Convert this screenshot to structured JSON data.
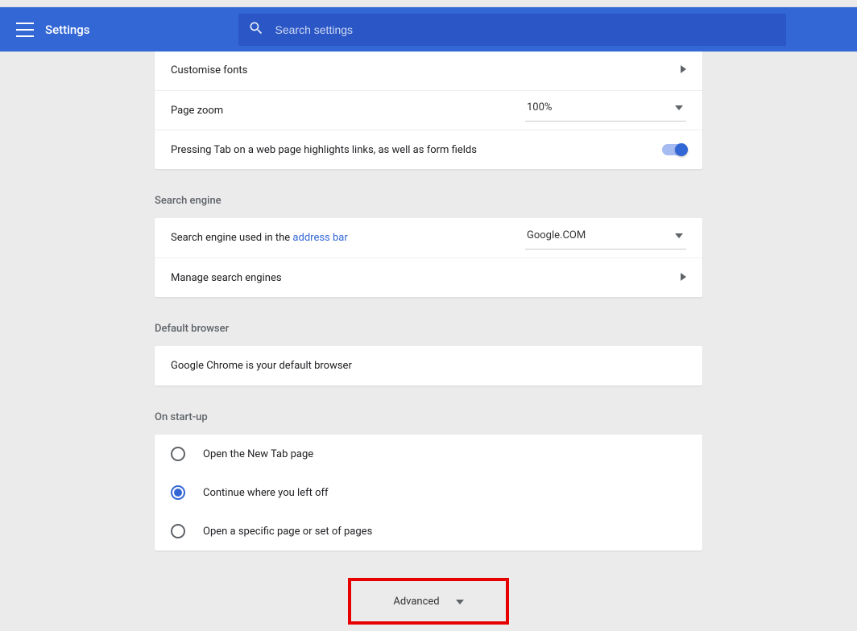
{
  "header": {
    "title": "Settings",
    "search_placeholder": "Search settings"
  },
  "appearance": {
    "customise_fonts": "Customise fonts",
    "page_zoom_label": "Page zoom",
    "page_zoom_value": "100%",
    "tab_highlight": "Pressing Tab on a web page highlights links, as well as form fields"
  },
  "search_engine": {
    "section": "Search engine",
    "used_in_prefix": "Search engine used in the ",
    "address_bar_link": "address bar",
    "value": "Google.COM",
    "manage": "Manage search engines"
  },
  "default_browser": {
    "section": "Default browser",
    "status": "Google Chrome is your default browser"
  },
  "on_startup": {
    "section": "On start-up",
    "opt1": "Open the New Tab page",
    "opt2": "Continue where you left off",
    "opt3": "Open a specific page or set of pages",
    "selected_index": 1
  },
  "advanced_label": "Advanced"
}
